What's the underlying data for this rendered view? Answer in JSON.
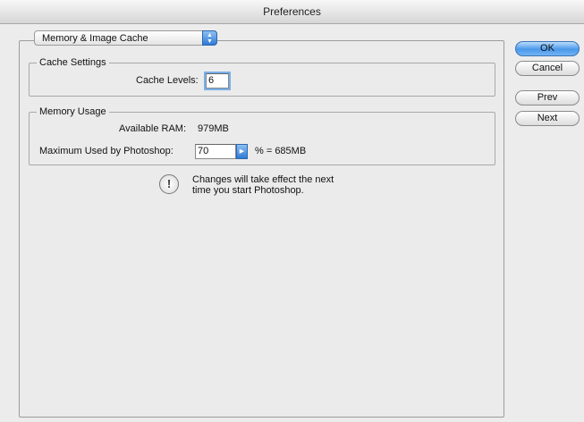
{
  "window": {
    "title": "Preferences"
  },
  "panel_selector": {
    "value": "Memory & Image Cache",
    "icon": "up-down-arrows-icon"
  },
  "cache_settings": {
    "title": "Cache Settings",
    "cache_levels_label": "Cache Levels:",
    "cache_levels_value": "6"
  },
  "memory_usage": {
    "title": "Memory Usage",
    "available_ram_label": "Available RAM:",
    "available_ram_value": "979MB",
    "max_used_label": "Maximum Used by Photoshop:",
    "max_used_value": "70",
    "max_used_suffix": "% = 685MB"
  },
  "notice": {
    "icon": "exclamation-icon",
    "line1": "Changes will take effect the next",
    "line2": "time you start Photoshop."
  },
  "buttons": {
    "ok": "OK",
    "cancel": "Cancel",
    "prev": "Prev",
    "next": "Next"
  },
  "colors": {
    "accent": "#4a98ea"
  }
}
